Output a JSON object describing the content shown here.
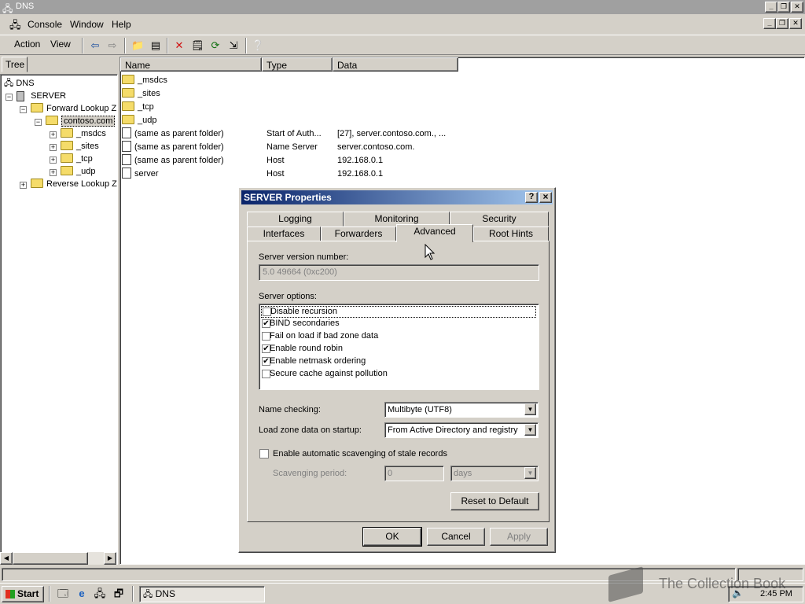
{
  "window": {
    "title": "DNS"
  },
  "menu": {
    "console": "Console",
    "window": "Window",
    "help": "Help"
  },
  "toolbar": {
    "action": "Action",
    "view": "View"
  },
  "tree": {
    "tab": "Tree",
    "nodes": [
      "DNS",
      "SERVER",
      "Forward Lookup Z",
      "contoso.com",
      "_msdcs",
      "_sites",
      "_tcp",
      "_udp",
      "Reverse Lookup Z"
    ]
  },
  "list": {
    "headers": {
      "name": "Name",
      "type": "Type",
      "data": "Data"
    },
    "rows": [
      {
        "name": "_msdcs",
        "type": "",
        "data": "",
        "icon": "folder"
      },
      {
        "name": "_sites",
        "type": "",
        "data": "",
        "icon": "folder"
      },
      {
        "name": "_tcp",
        "type": "",
        "data": "",
        "icon": "folder"
      },
      {
        "name": "_udp",
        "type": "",
        "data": "",
        "icon": "folder"
      },
      {
        "name": "(same as parent folder)",
        "type": "Start of Auth...",
        "data": "[27], server.contoso.com., ...",
        "icon": "record"
      },
      {
        "name": "(same as parent folder)",
        "type": "Name Server",
        "data": "server.contoso.com.",
        "icon": "record"
      },
      {
        "name": "(same as parent folder)",
        "type": "Host",
        "data": "192.168.0.1",
        "icon": "record"
      },
      {
        "name": "server",
        "type": "Host",
        "data": "192.168.0.1",
        "icon": "record"
      }
    ]
  },
  "dialog": {
    "title": "SERVER Properties",
    "help": "?",
    "close": "×",
    "tabs_row1": [
      "Logging",
      "Monitoring",
      "Security"
    ],
    "tabs_row2": [
      "Interfaces",
      "Forwarders",
      "Advanced",
      "Root Hints"
    ],
    "active_tab": "Advanced",
    "version_label": "Server version number:",
    "version_value": "5.0 49664 (0xc200)",
    "options_label": "Server options:",
    "options": [
      {
        "label": "Disable recursion",
        "checked": false
      },
      {
        "label": "BIND secondaries",
        "checked": true
      },
      {
        "label": "Fail on load if bad zone data",
        "checked": false
      },
      {
        "label": "Enable round robin",
        "checked": true
      },
      {
        "label": "Enable netmask ordering",
        "checked": true
      },
      {
        "label": "Secure cache against pollution",
        "checked": false
      }
    ],
    "name_checking_label": "Name checking:",
    "name_checking_value": "Multibyte (UTF8)",
    "load_zone_label": "Load zone data on startup:",
    "load_zone_value": "From Active Directory and registry",
    "scavenging_label": "Enable automatic scavenging of stale records",
    "scavenging_checked": false,
    "scavenging_period_label": "Scavenging period:",
    "scavenging_period_value": "0",
    "scavenging_unit": "days",
    "reset_button": "Reset to Default",
    "ok_button": "OK",
    "cancel_button": "Cancel",
    "apply_button": "Apply"
  },
  "taskbar": {
    "start": "Start",
    "task": "DNS",
    "clock": "2:45 PM"
  },
  "watermark": "The Collection Book"
}
